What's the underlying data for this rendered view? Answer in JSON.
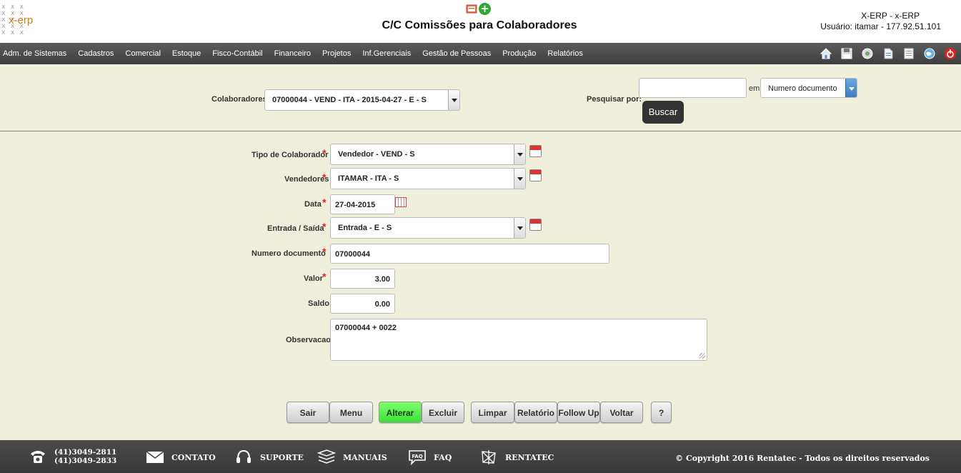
{
  "header": {
    "logo_text": "x-erp",
    "title": "C/C Comissões para Colaboradores",
    "user_line1": "X-ERP - x-ERP",
    "user_line2": "Usuário: itamar - 177.92.51.101"
  },
  "menu": {
    "items": [
      "Adm. de Sistemas",
      "Cadastros",
      "Comercial",
      "Estoque",
      "Fisco-Contábil",
      "Financeiro",
      "Projetos",
      "Inf.Gerenciais",
      "Gestão de Pessoas",
      "Produção",
      "Relatórios"
    ],
    "toolbar_icons": [
      "home-icon",
      "save-icon",
      "settings-icon",
      "document-icon",
      "notepad-icon",
      "globe-icon",
      "power-icon"
    ]
  },
  "search": {
    "colaboradores_label": "Colaboradores",
    "colaboradores_value": "07000044 - VEND - ITA - 2015-04-27 - E - S",
    "pesquisar_label": "Pesquisar por:",
    "search_value": "",
    "em_label": "em",
    "field_value": "Numero documento",
    "buscar_label": "Buscar"
  },
  "form": {
    "tipo_label": "Tipo de Colaborador",
    "tipo_value": "Vendedor - VEND - S",
    "vendedores_label": "Vendedores",
    "vendedores_value": "ITAMAR - ITA - S",
    "data_label": "Data",
    "data_value": "27-04-2015",
    "entrada_label": "Entrada / Saída",
    "entrada_value": "Entrada - E - S",
    "numero_label": "Numero documento",
    "numero_value": "07000044",
    "valor_label": "Valor",
    "valor_value": "3.00",
    "saldo_label": "Saldo",
    "saldo_value": "0.00",
    "obs_label": "Observacao",
    "obs_value": "07000044 + 0022",
    "required_mark": "*"
  },
  "actions": {
    "sair": "Sair",
    "menu": "Menu",
    "alterar": "Alterar",
    "excluir": "Excluir",
    "limpar": "Limpar",
    "relatorio": "Relatório",
    "followup": "Follow Up",
    "voltar": "Voltar",
    "help": "?"
  },
  "footer": {
    "phone1": "(41)3049-2811",
    "phone2": "(41)3049-2833",
    "contato": "CONTATO",
    "suporte": "SUPORTE",
    "manuais": "MANUAIS",
    "faq": "FAQ",
    "rentatec": "RENTATEC",
    "copyright": "© Copyright 2016 Rentatec - Todos os direitos reservados"
  },
  "colors": {
    "background": "#efefdc",
    "menubar": "#4a4a4a",
    "alterar_green": "#4cf046",
    "required_red": "#e02020"
  }
}
